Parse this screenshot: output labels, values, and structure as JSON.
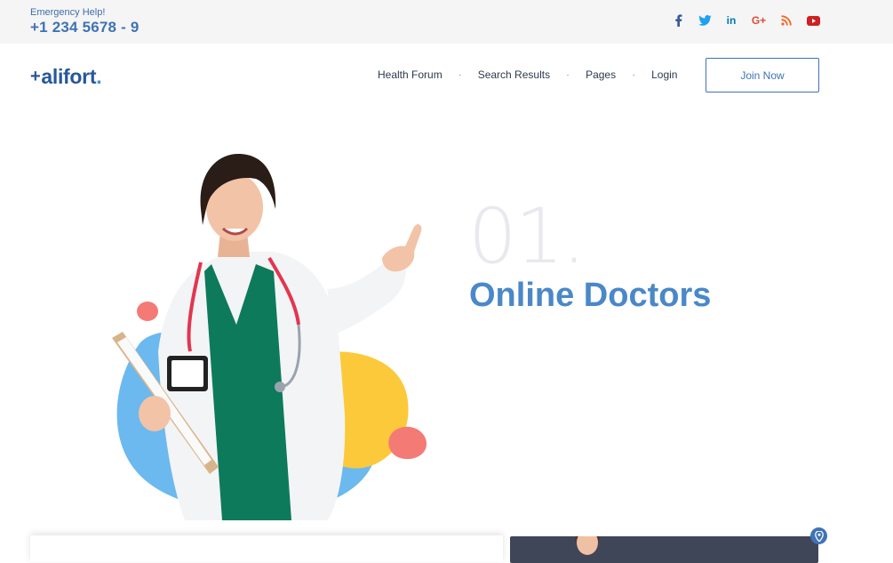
{
  "topbar": {
    "emergency_label": "Emergency Help!",
    "emergency_phone": "+1 234 5678 - 9",
    "socials": [
      {
        "icon": "facebook-icon",
        "glyph": "f",
        "color": "#3b5998"
      },
      {
        "icon": "twitter-icon",
        "glyph": "t",
        "color": "#1da1f2"
      },
      {
        "icon": "linkedin-icon",
        "glyph": "in",
        "color": "#0077b5"
      },
      {
        "icon": "google-plus-icon",
        "glyph": "G+",
        "color": "#dd4b39"
      },
      {
        "icon": "rss-icon",
        "glyph": "rss",
        "color": "#f26522"
      },
      {
        "icon": "youtube-icon",
        "glyph": "yt",
        "color": "#cd201f"
      }
    ]
  },
  "nav": {
    "logo_text": "alifort",
    "logo_dot": ".",
    "logo_plus": "+",
    "menu": [
      "Health Forum",
      "Search Results",
      "Pages",
      "Login"
    ],
    "separator": "·",
    "join_label": "Join Now"
  },
  "hero": {
    "slide_number": "01.",
    "slide_title": "Online Doctors"
  },
  "colors": {
    "brand_blue": "#3f73b5",
    "title_blue": "#4a88c8",
    "topbar_bg": "#f5f5f6",
    "dark_card": "#3f4658"
  }
}
